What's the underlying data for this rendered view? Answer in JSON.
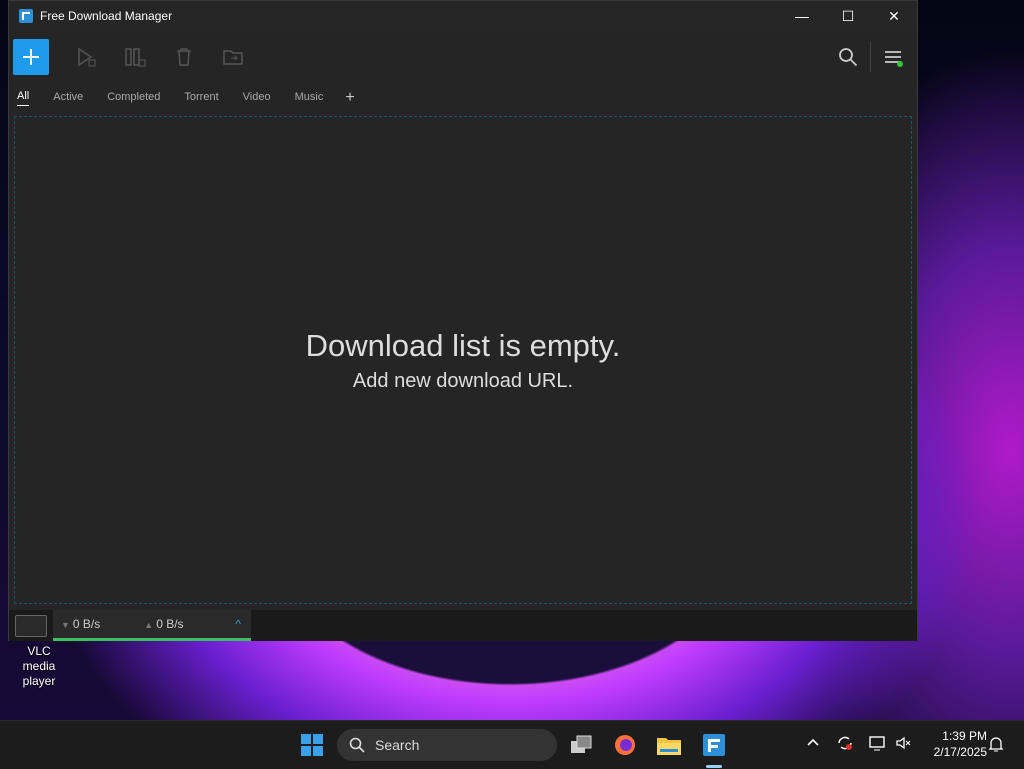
{
  "window": {
    "title": "Free Download Manager",
    "controls": {
      "minimize": "—",
      "maximize": "☐",
      "close": "✕"
    }
  },
  "toolbar": {
    "add_label": "+",
    "icons": [
      "play-icon",
      "pause-icon",
      "delete-icon",
      "move-folder-icon"
    ]
  },
  "tabs": [
    {
      "label": "All",
      "active": true
    },
    {
      "label": "Active"
    },
    {
      "label": "Completed"
    },
    {
      "label": "Torrent"
    },
    {
      "label": "Video"
    },
    {
      "label": "Music"
    }
  ],
  "tab_add_label": "+",
  "empty": {
    "title": "Download list is empty.",
    "subtitle": "Add new download URL."
  },
  "status": {
    "download_speed": "0 B/s",
    "upload_speed": "0 B/s",
    "down_arrow": "▼",
    "up_arrow": "▲",
    "expand": "^"
  },
  "desktop": {
    "vlc_label_line1": "VLC media",
    "vlc_label_line2": "player"
  },
  "taskbar": {
    "search_placeholder": "Search",
    "time": "1:39 PM",
    "date": "2/17/2025"
  },
  "colors": {
    "accent": "#1e9bea",
    "status_green": "#3cbf5a",
    "window_bg": "#252525"
  }
}
